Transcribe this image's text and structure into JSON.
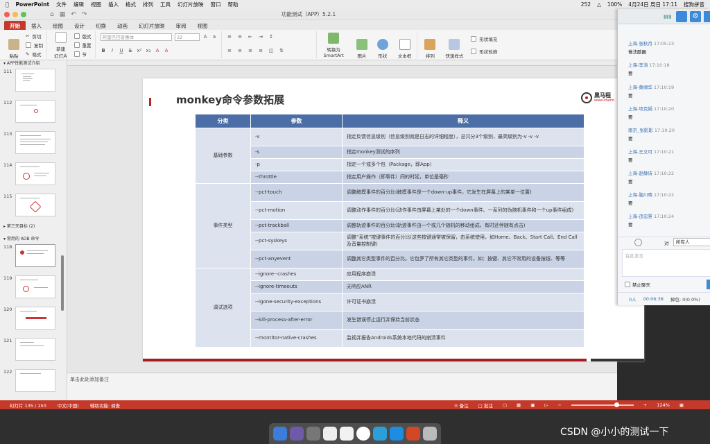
{
  "menubar": {
    "app": "PowerPoint",
    "items": [
      "文件",
      "编辑",
      "视图",
      "插入",
      "格式",
      "排列",
      "工具",
      "幻灯片放映",
      "窗口",
      "帮助"
    ],
    "status": {
      "count": "252",
      "battery": "100%",
      "datetime": "4月24日 周日 17:11",
      "ime": "搜狗拼音"
    }
  },
  "titlebar": {
    "title": "功能测试（APP）5.2.1"
  },
  "ribbon": {
    "tabs": [
      "开始",
      "插入",
      "绘图",
      "设计",
      "切换",
      "动画",
      "幻灯片放映",
      "审阅",
      "视图"
    ],
    "active_tab": "开始",
    "paste": "粘贴",
    "cut": "剪切",
    "copy": "复制",
    "format": "格式",
    "new_slide": "新建\n幻灯片",
    "layout": "版式",
    "reset": "重置",
    "section": "节",
    "font_name": "阿里巴巴普惠体",
    "font_size": "32",
    "convert": "转换为\nSmartArt",
    "picture": "图片",
    "shape": "形状",
    "textbox": "文本框",
    "arrange": "排列",
    "quick_styles": "快速样式",
    "shape_fill": "形状填充",
    "shape_outline": "形状轮廓"
  },
  "thumbs": {
    "section_top": "APP性能测试介绍",
    "slides": [
      "111",
      "112",
      "113",
      "114",
      "115"
    ],
    "section_mid": "第三天目标 (2)",
    "section_adb": "常用的 ADB 命令",
    "slides2": [
      "118",
      "119",
      "120",
      "121",
      "122"
    ]
  },
  "slide": {
    "title": "monkey命令参数拓展",
    "logo_name": "黑马程",
    "logo_sub": "www.itheim",
    "headers": [
      "分类",
      "参数",
      "释义"
    ],
    "groups": [
      {
        "category": "基础参数",
        "rows": [
          {
            "param": "-v",
            "desc": "指定反馈信息级别（信息级别就是日志的详细程度），总共分3个级别，最高级别为-v -v -v"
          },
          {
            "param": "-s",
            "desc": "指定monkey测试的序列"
          },
          {
            "param": "-p",
            "desc": "指定一个或多个包（Package，即App）"
          },
          {
            "param": "--throttle",
            "desc": "指定用户操作（即事件）间的时延，单位是毫秒"
          }
        ]
      },
      {
        "category": "事件类型",
        "rows": [
          {
            "param": "--pct-touch",
            "desc": "调整触摸事件的百分比(触摸事件是一个down-up事件，它发生在屏幕上的某单一位置)"
          },
          {
            "param": "--pct-motion",
            "desc": "调整动作事件的百分比(动作事件由屏幕上某处的一个down事件、一系列的伪随机事件和一个up事件组成)"
          },
          {
            "param": "--pct-trackball",
            "desc": "调整轨迹事件的百分比(轨迹事件由一个或几个随机的移动组成，有时还伴随有点击)"
          },
          {
            "param": "--pct-syskeys",
            "desc": "调整“系统”按键事件的百分比(这些按键通常被保留，由系统使用，如Home、Back、Start Call、End Call及音量控制键)"
          },
          {
            "param": "--pct-anyevent",
            "desc": "调整其它类型事件的百分比。它包罗了所有其它类型的事件，如：按键、其它不常用的设备按钮、等等"
          }
        ]
      },
      {
        "category": "调试选项",
        "rows": [
          {
            "param": "--ignore--crashes",
            "desc": "应用程序崩溃"
          },
          {
            "param": "--ignore-timeouts",
            "desc": "无响应ANR"
          },
          {
            "param": "--igone-security-exceptions",
            "desc": "许可证书崩溃"
          },
          {
            "param": "--kill-process-after-error",
            "desc": "发生错误停止运行并保持当前状态"
          },
          {
            "param": "--montitor-native-crashes",
            "desc": "监视并报告Androids系统本地代码的崩溃事件"
          }
        ]
      }
    ]
  },
  "notes": {
    "placeholder": "单击此处添加备注"
  },
  "status": {
    "slide_pos": "幻灯片 135 / 150",
    "lang": "中文(中国)",
    "accessibility": "辅助功能: 调查",
    "notes": "备注",
    "comments": "批注",
    "zoom": "124%",
    "zoom_level": 0.72
  },
  "chat": {
    "messages": [
      {
        "who": "上海-张秋月",
        "time": "17:05:23",
        "text": "做法酷圈"
      },
      {
        "who": "上海-李涛",
        "time": "17:10:18",
        "text": "要"
      },
      {
        "who": "上海-黄顺华",
        "time": "17:10:19",
        "text": "要"
      },
      {
        "who": "上海-项克娟",
        "time": "17:10:20",
        "text": "要"
      },
      {
        "who": "南京_张影影",
        "time": "17:10:20",
        "text": "要"
      },
      {
        "who": "上海-王文可",
        "time": "17:10:21",
        "text": "要"
      },
      {
        "who": "上海-赵静诗",
        "time": "17:10:22",
        "text": "要"
      },
      {
        "who": "上海-脑川晴",
        "time": "17:10:22",
        "text": "要"
      },
      {
        "who": "上海-违忠慧",
        "time": "17:10:24",
        "text": "要"
      }
    ],
    "to_label": "对",
    "to_value": "所有人",
    "input_placeholder": "在此发言",
    "ban_label": "禁止聊天",
    "people": "0人",
    "duration": "00:06:38",
    "loss": "掉包: 0(0.0%)"
  },
  "watermark": "CSDN @小小的测试一下"
}
